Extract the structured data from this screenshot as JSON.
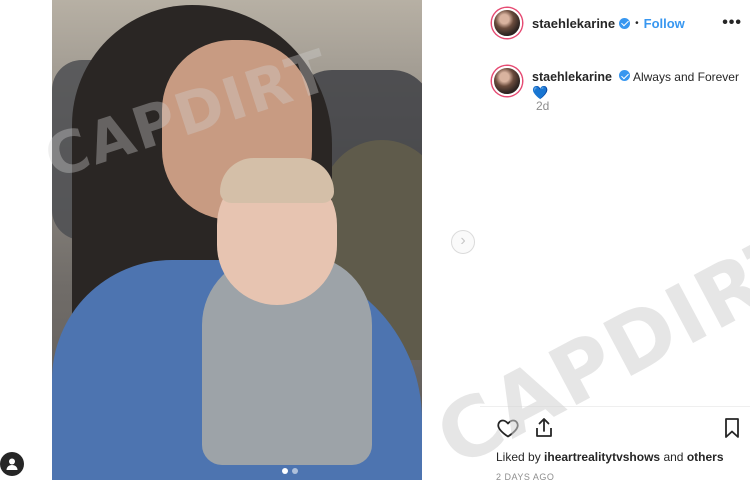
{
  "post": {
    "image_alt": "photo of woman and baby",
    "carousel": {
      "count": 2,
      "current": 1
    }
  },
  "header": {
    "username": "staehlekarine",
    "follow_label": "Follow",
    "more_icon": "more-horizontal-icon"
  },
  "caption": {
    "username": "staehlekarine",
    "text": "Always and Forever",
    "emoji": "💙",
    "time": "2d"
  },
  "actions": {
    "like_icon": "heart-icon",
    "share_icon": "share-icon",
    "save_icon": "bookmark-icon"
  },
  "likes": {
    "prefix": "Liked by",
    "user": "iheartrealitytvshows",
    "and": "and",
    "others": "others"
  },
  "date_text": "2 DAYS AGO",
  "watermark": "CAPDIRT",
  "colors": {
    "accent": "#3897f0",
    "verified": "#3897f0",
    "text": "#262626",
    "muted": "#8e8e8e",
    "ring": "#e64b73"
  }
}
